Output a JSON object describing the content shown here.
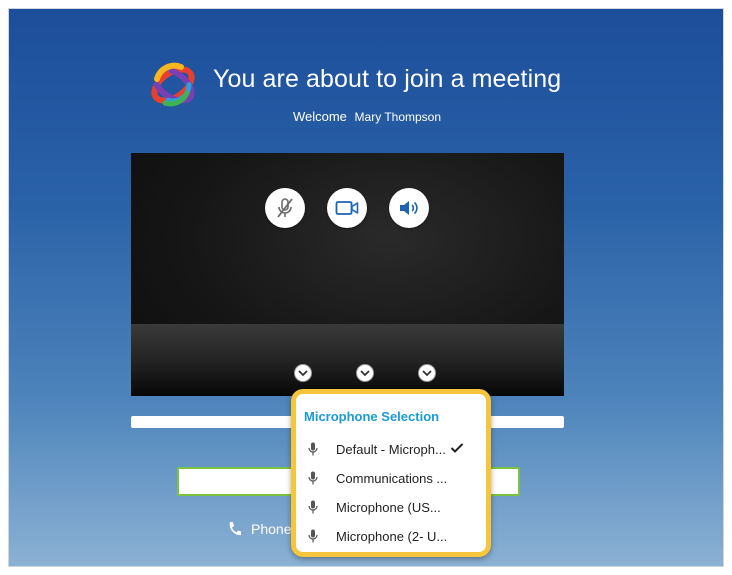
{
  "header": {
    "title": "You are about to join a meeting",
    "welcome_label": "Welcome",
    "user_name": "Mary Thompson"
  },
  "logo": {
    "icon": "colorful-swirl-logo"
  },
  "controls": {
    "mic_icon": "microphone-muted-icon",
    "camera_icon": "video-camera-icon",
    "speaker_icon": "speaker-icon"
  },
  "phone": {
    "label": "Phone"
  },
  "microphone_dropdown": {
    "title": "Microphone Selection",
    "items": [
      {
        "label": "Default - Microph...",
        "selected": true
      },
      {
        "label": "Communications ...",
        "selected": false
      },
      {
        "label": "Microphone (US...",
        "selected": false
      },
      {
        "label": "Microphone (2- U...",
        "selected": false
      }
    ]
  },
  "colors": {
    "accent_title": "#1a9bd7",
    "dropdown_border": "#f6c53c",
    "button_border": "#7cc242",
    "background_top": "#1c4e9a"
  }
}
